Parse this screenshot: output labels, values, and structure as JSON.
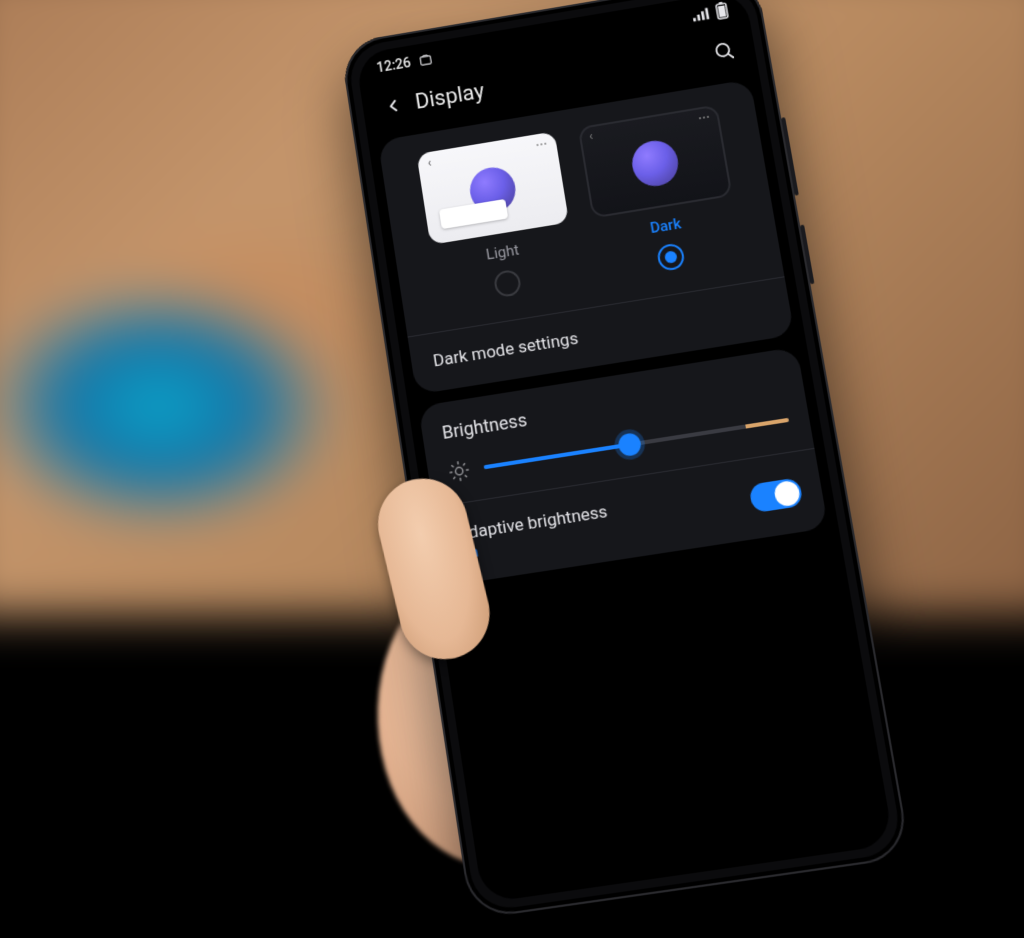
{
  "status": {
    "time": "12:26"
  },
  "header": {
    "title": "Display"
  },
  "theme": {
    "light_label": "Light",
    "dark_label": "Dark",
    "selected": "dark"
  },
  "dark_mode_settings_label": "Dark mode settings",
  "brightness": {
    "title": "Brightness",
    "value_percent": 48
  },
  "adaptive": {
    "title": "Adaptive brightness",
    "state_label": "On",
    "on": true
  },
  "colors": {
    "accent": "#1a82ff"
  }
}
